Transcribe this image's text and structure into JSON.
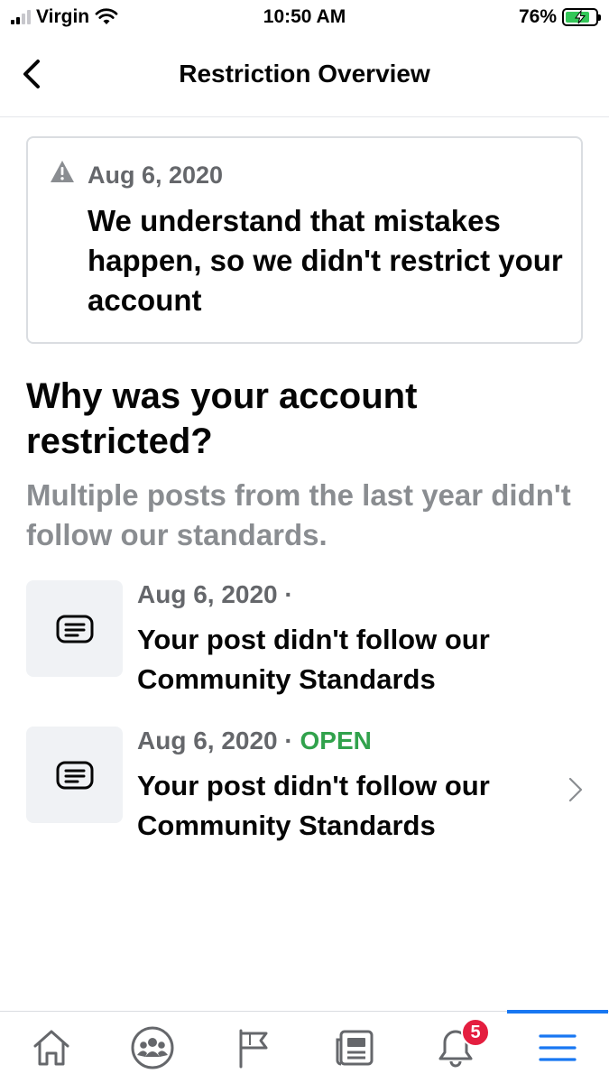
{
  "status_bar": {
    "carrier": "Virgin",
    "time": "10:50 AM",
    "battery": "76%"
  },
  "header": {
    "title": "Restriction Overview",
    "back_icon": "chevron-left-icon"
  },
  "notice": {
    "icon": "warning-icon",
    "date": "Aug 6, 2020",
    "message": "We understand that mistakes happen, so we didn't restrict your account"
  },
  "reason": {
    "title": "Why was your account restricted?",
    "subtitle": "Multiple posts from the last year didn't follow our standards."
  },
  "items": [
    {
      "icon": "post-icon",
      "date": "Aug 6, 2020 ·",
      "status": "",
      "text": "Your post didn't follow our Community Standards"
    },
    {
      "icon": "post-icon",
      "date": "Aug 6, 2020 ·",
      "status": "OPEN",
      "text": "Your post didn't follow our Community Standards"
    }
  ],
  "tabbar": {
    "tabs": [
      "home-icon",
      "groups-icon",
      "pages-flag-icon",
      "news-icon",
      "notifications-bell-icon",
      "menu-icon"
    ],
    "notifications_badge": "5",
    "active_tab": "menu-icon"
  },
  "colors": {
    "accent": "#1877f2",
    "open_status": "#31a24c",
    "secondary_text": "#65676b",
    "badge": "#e41e3f"
  }
}
